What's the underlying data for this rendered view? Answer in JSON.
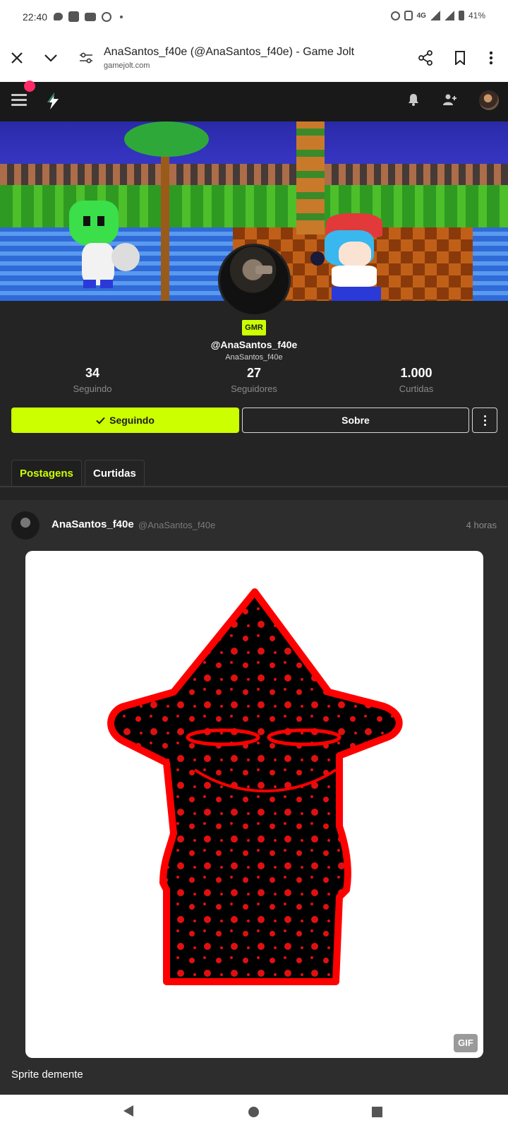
{
  "status_bar": {
    "time": "22:40",
    "network": "4G",
    "battery": "41%",
    "icons": [
      "chat-icon",
      "plus-app-icon",
      "youtube-icon",
      "vpn-icon",
      "alarm-icon",
      "vibrate-icon",
      "signal-icon",
      "battery-icon"
    ]
  },
  "browser": {
    "title": "AnaSantos_f40e (@AnaSantos_f40e) - Game Jolt",
    "url": "gamejolt.com",
    "icons": [
      "close-icon",
      "chevron-down-icon",
      "site-settings-icon",
      "share-icon",
      "bookmark-icon",
      "more-vertical-icon"
    ]
  },
  "app_header": {
    "icons": [
      "menu-icon",
      "gamejolt-logo-icon",
      "bell-icon",
      "add-friend-icon",
      "user-avatar"
    ],
    "colors": {
      "background": "#191919",
      "notification": "#ff2a66"
    }
  },
  "profile": {
    "badge": "GMR",
    "handle": "@AnaSantos_f40e",
    "display_name": "AnaSantos_f40e",
    "stats": [
      {
        "value": "34",
        "label": "Seguindo"
      },
      {
        "value": "27",
        "label": "Seguidores"
      },
      {
        "value": "1.000",
        "label": "Curtidas"
      }
    ],
    "follow_button": "Seguindo",
    "about_button": "Sobre",
    "accent_color": "#ccff00"
  },
  "tabs": [
    {
      "label": "Postagens",
      "active": true
    },
    {
      "label": "Curtidas",
      "active": false
    }
  ],
  "post": {
    "author": "AnaSantos_f40e",
    "author_handle": "@AnaSantos_f40e",
    "time": "4 horas",
    "media_badge": "GIF",
    "caption": "Sprite demente"
  },
  "nav": {
    "icons": [
      "back-icon",
      "home-icon",
      "recents-icon"
    ]
  }
}
